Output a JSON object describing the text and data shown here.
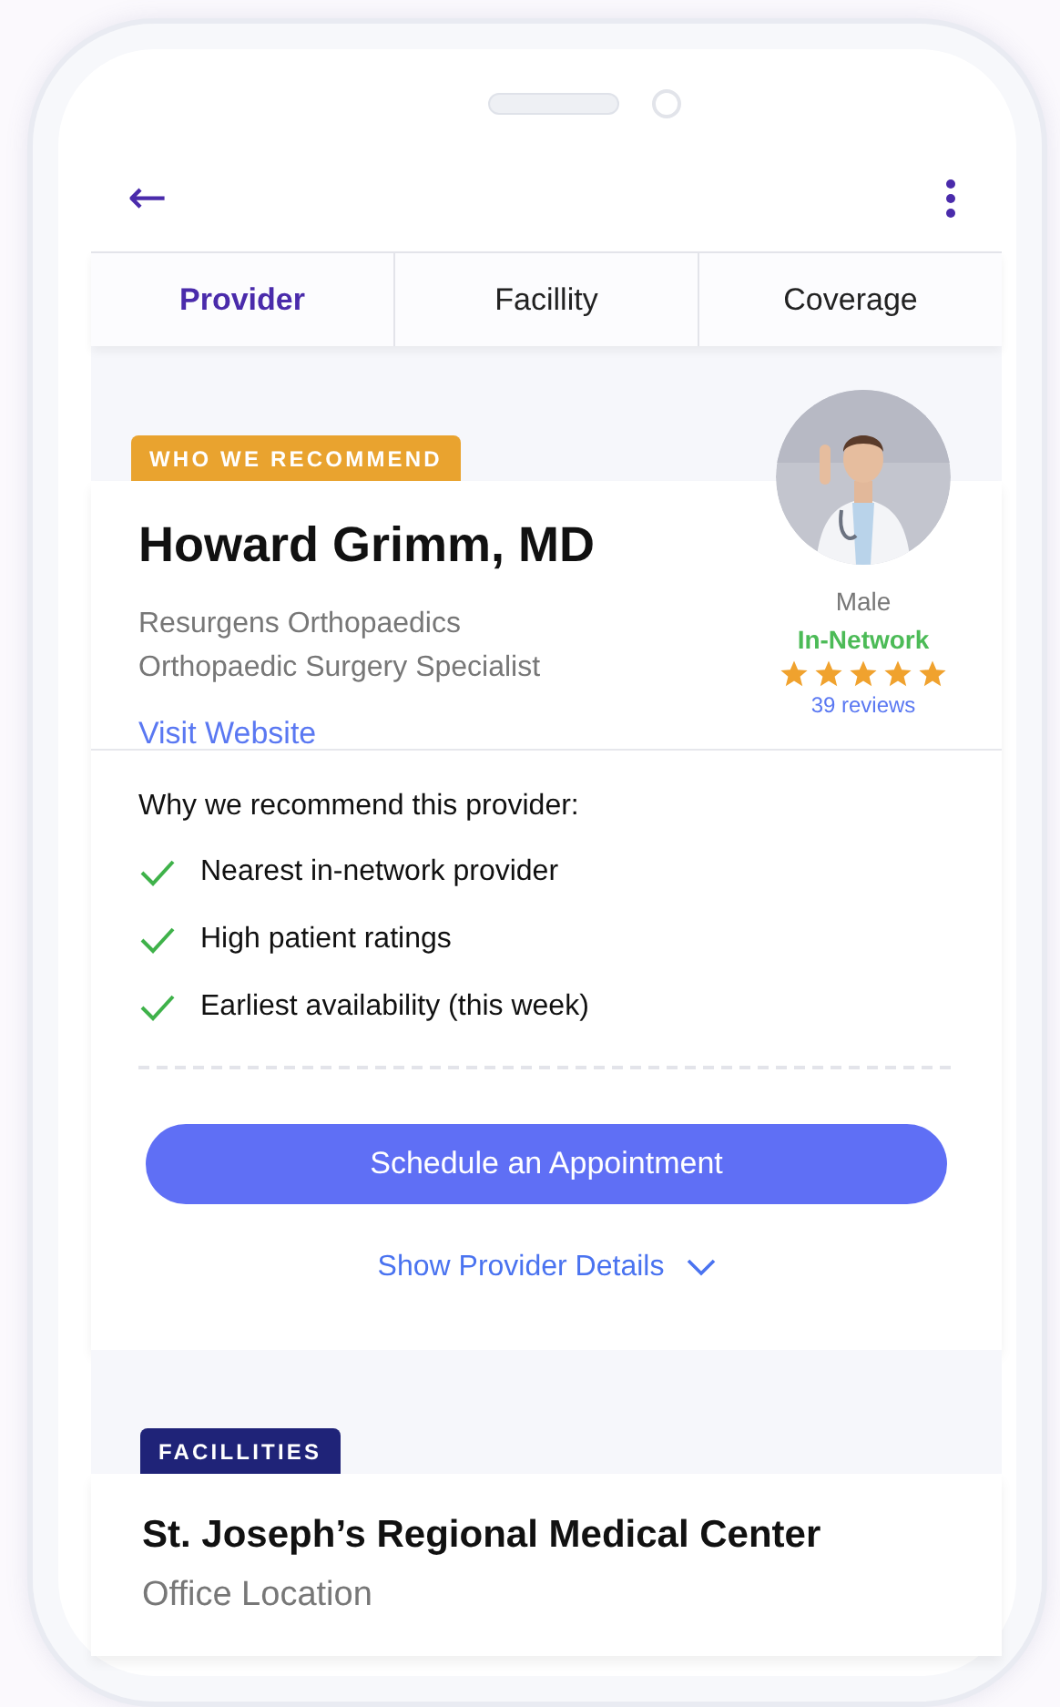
{
  "header": {
    "back": "←"
  },
  "tabs": [
    {
      "label": "Provider",
      "selected": true
    },
    {
      "label": "Facillity",
      "selected": false
    },
    {
      "label": "Coverage",
      "selected": false
    }
  ],
  "provider": {
    "badge": "WHO WE RECOMMEND",
    "name": "Howard Grimm, MD",
    "practice": "Resurgens Orthopaedics",
    "specialty": "Orthopaedic Surgery Specialist",
    "link": "Visit Website",
    "gender": "Male",
    "network": "In-Network",
    "stars": 5,
    "reviews": "39  reviews"
  },
  "reasons": {
    "title": "Why we recommend this provider:",
    "items": [
      {
        "text": "Nearest in-network provider",
        "checked": true
      },
      {
        "text": "High patient ratings",
        "checked": true
      },
      {
        "text": "Earliest availability (this week)",
        "checked": true
      }
    ]
  },
  "schedule_button": "Schedule an Appointment",
  "details_toggle": {
    "label": "Show Provider Details",
    "expanded": false
  },
  "facility": {
    "badge": "FACILLITIES",
    "name": "St. Joseph’s Regional Medical Center",
    "subtitle": "Office Location"
  }
}
